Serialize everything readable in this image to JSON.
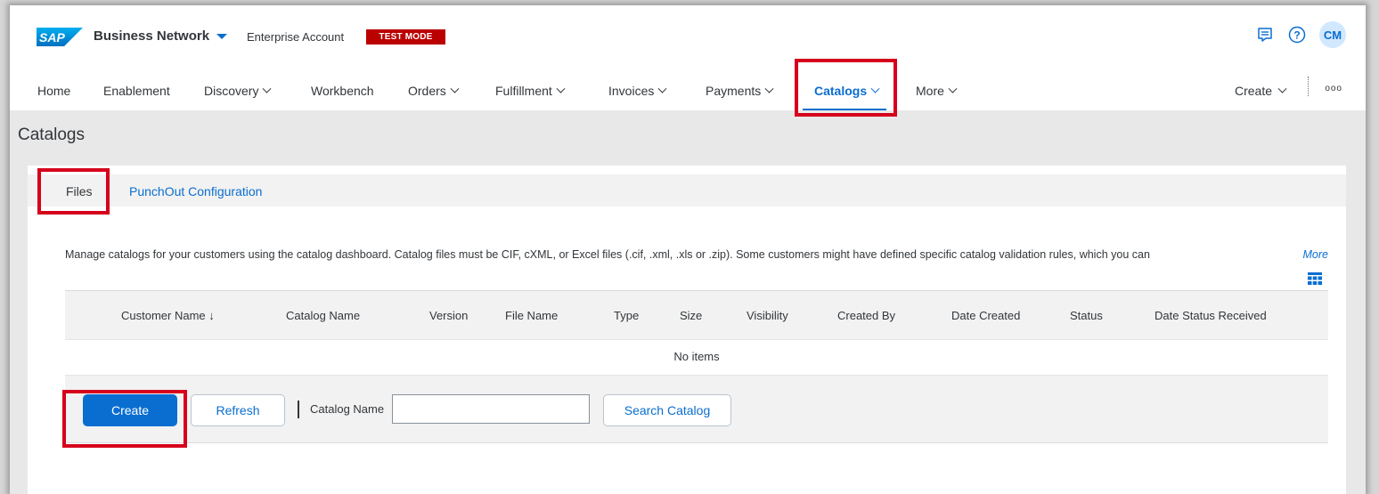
{
  "shell": {
    "product": "Business Network",
    "account": "Enterprise Account",
    "mode_badge": "TEST MODE",
    "avatar_initials": "CM",
    "logo_text": "SAP"
  },
  "nav": {
    "items": [
      {
        "label": "Home"
      },
      {
        "label": "Enablement"
      },
      {
        "label": "Discovery"
      },
      {
        "label": "Workbench"
      },
      {
        "label": "Orders"
      },
      {
        "label": "Fulfillment"
      },
      {
        "label": "Invoices"
      },
      {
        "label": "Payments"
      },
      {
        "label": "Catalogs"
      },
      {
        "label": "More"
      }
    ],
    "create_label": "Create",
    "overflow_label": "ooo"
  },
  "page": {
    "title": "Catalogs"
  },
  "subtabs": {
    "files": "Files",
    "punchout": "PunchOut Configuration"
  },
  "description": "Manage catalogs for your customers using the catalog dashboard. Catalog files must be CIF, cXML, or Excel files (.cif, .xml, .xls or .zip). Some customers might have defined specific catalog validation rules, which you can",
  "more_link": "More",
  "table": {
    "columns": [
      "Customer Name ↓",
      "Catalog Name",
      "Version",
      "File Name",
      "Type",
      "Size",
      "Visibility",
      "Created By",
      "Date Created",
      "Status",
      "Date Status Received"
    ],
    "empty_text": "No items"
  },
  "toolbar": {
    "create_label": "Create",
    "refresh_label": "Refresh",
    "catalog_name_label": "Catalog Name",
    "catalog_name_value": "",
    "search_label": "Search Catalog"
  },
  "colors": {
    "brand_blue": "#0a6ed1",
    "test_mode_red": "#bb0000",
    "highlight_red": "#d6001c"
  }
}
